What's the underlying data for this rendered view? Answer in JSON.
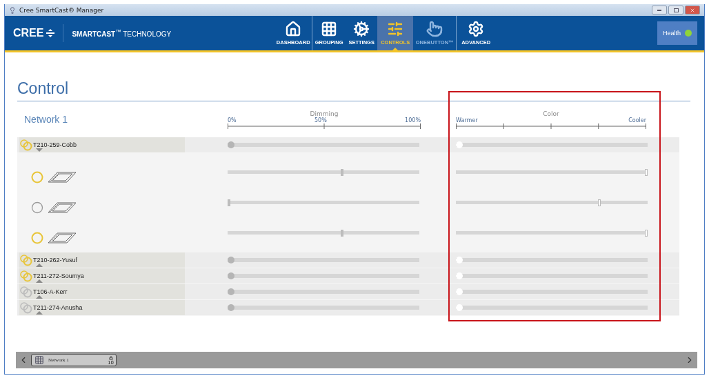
{
  "window": {
    "title": "Cree SmartCast® Manager"
  },
  "header": {
    "logo": "CREE",
    "tagline_bold": "SMARTCAST",
    "tagline_mark": "™",
    "tagline": "TECHNOLOGY",
    "nav": [
      {
        "label": "DASHBOARD",
        "selected": false,
        "disabled": false
      },
      {
        "label": "GROUPING",
        "selected": false,
        "disabled": false
      },
      {
        "label": "SETTINGS",
        "selected": false,
        "disabled": false
      },
      {
        "label": "CONTROLS",
        "selected": true,
        "disabled": false
      },
      {
        "label": "ONEBUTTON™",
        "selected": false,
        "disabled": true
      },
      {
        "label": "ADVANCED",
        "selected": false,
        "disabled": false
      }
    ],
    "health": {
      "label": "Health",
      "color": "#8fd43a"
    }
  },
  "page": {
    "title": "Control",
    "network": "Network 1",
    "dimming": {
      "title": "Dimming",
      "ticks": [
        "0%",
        "50%",
        "100%"
      ]
    },
    "color": {
      "title": "Color",
      "start": "Warmer",
      "end": "Cooler"
    },
    "highlight_color_column": true
  },
  "rows": [
    {
      "kind": "group",
      "name": "T210-259-Cobb",
      "on": true,
      "expanded": true,
      "dimming": {
        "level": 0
      },
      "color": {
        "level": 0
      },
      "children": [
        {
          "kind": "fixture",
          "on": true,
          "dimming": {
            "level": 0.6
          },
          "color": {
            "level": 1
          }
        },
        {
          "kind": "fixture",
          "on": false,
          "dimming": {
            "level": 0
          },
          "color": {
            "level": 0.75
          }
        },
        {
          "kind": "fixture",
          "on": true,
          "dimming": {
            "level": 0.6
          },
          "color": {
            "level": 1
          }
        }
      ]
    },
    {
      "kind": "group",
      "name": "T210-262-Yusuf",
      "on": true,
      "expanded": false,
      "dimming": {
        "level": 0
      },
      "color": {
        "level": 0
      }
    },
    {
      "kind": "group",
      "name": "T211-272-Soumya",
      "on": true,
      "expanded": false,
      "dimming": {
        "level": 0
      },
      "color": {
        "level": 0
      }
    },
    {
      "kind": "group",
      "name": "T106-A-Kerr",
      "on": false,
      "expanded": false,
      "dimming": {
        "level": 0
      },
      "color": {
        "level": 0
      }
    },
    {
      "kind": "group",
      "name": "T211-274-Anusha",
      "on": false,
      "expanded": false,
      "dimming": {
        "level": 0
      },
      "color": {
        "level": 0
      }
    }
  ],
  "bottom_bar": {
    "tabs": [
      {
        "label": "Network 1",
        "count": "10",
        "selected": true
      }
    ]
  }
}
